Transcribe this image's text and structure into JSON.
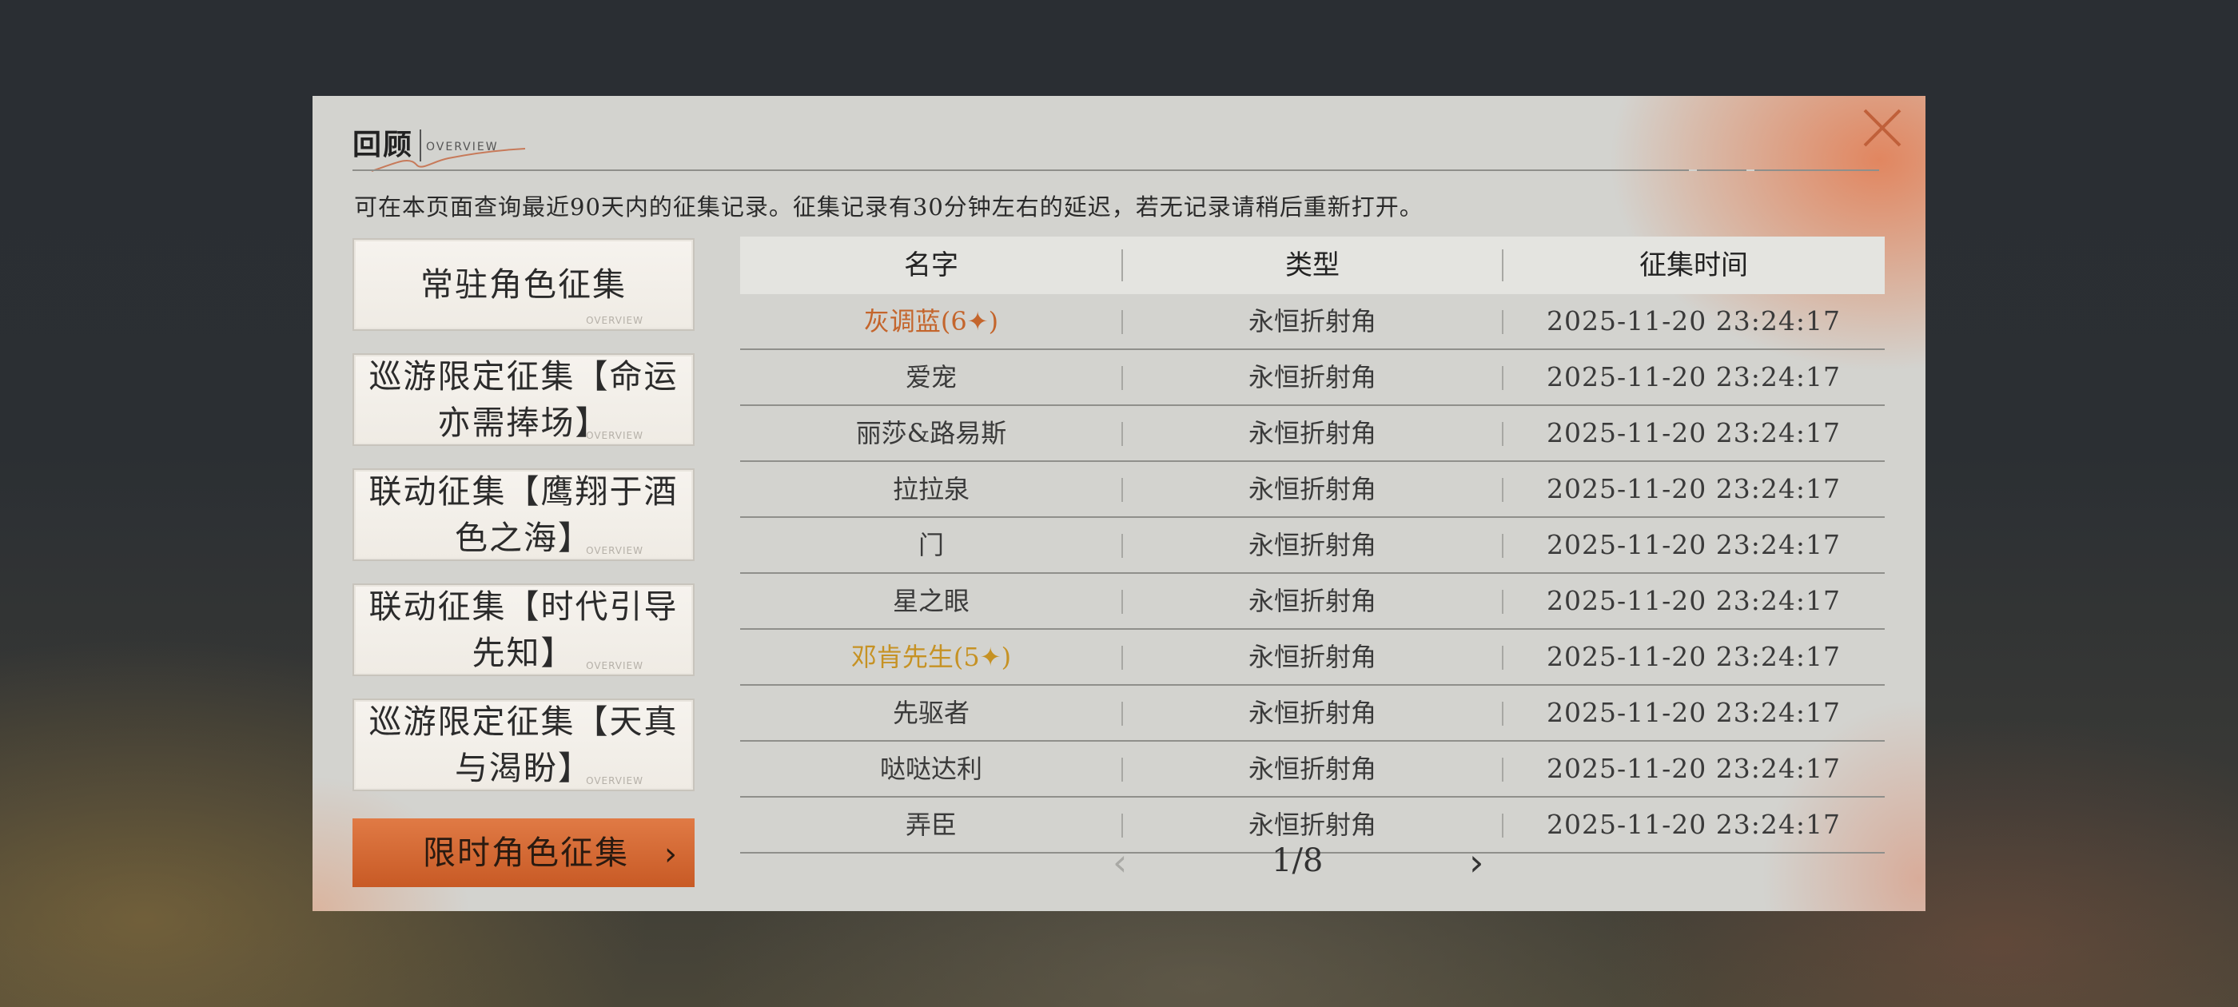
{
  "dialog": {
    "title": "回顾",
    "subtitle": "OVERVIEW",
    "description": "可在本页面查询最近90天内的征集记录。征集记录有30分钟左右的延迟，若无记录请稍后重新打开。",
    "close_icon": "close-icon"
  },
  "tabs": [
    {
      "label": "常驻角色征集",
      "overview": "OVERVIEW",
      "active": false
    },
    {
      "label": "巡游限定征集【命运亦需捧场】",
      "overview": "OVERVIEW",
      "active": false
    },
    {
      "label": "联动征集【鹰翔于酒色之海】",
      "overview": "OVERVIEW",
      "active": false
    },
    {
      "label": "联动征集【时代引导先知】",
      "overview": "OVERVIEW",
      "active": false
    },
    {
      "label": "巡游限定征集【天真与渴盼】",
      "overview": "OVERVIEW",
      "active": false
    },
    {
      "label": "限时角色征集",
      "active": true,
      "icon": "chevron-right-icon"
    }
  ],
  "table": {
    "headers": [
      "名字",
      "类型",
      "征集时间"
    ],
    "rows": [
      {
        "name": "灰调蓝(6✦)",
        "type": "永恒折射角",
        "time": "2025-11-20 23:24:17",
        "highlight": "#c4652c"
      },
      {
        "name": "爱宠",
        "type": "永恒折射角",
        "time": "2025-11-20 23:24:17"
      },
      {
        "name": "丽莎&路易斯",
        "type": "永恒折射角",
        "time": "2025-11-20 23:24:17"
      },
      {
        "name": "拉拉泉",
        "type": "永恒折射角",
        "time": "2025-11-20 23:24:17"
      },
      {
        "name": "门",
        "type": "永恒折射角",
        "time": "2025-11-20 23:24:17"
      },
      {
        "name": "星之眼",
        "type": "永恒折射角",
        "time": "2025-11-20 23:24:17"
      },
      {
        "name": "邓肯先生(5✦)",
        "type": "永恒折射角",
        "time": "2025-11-20 23:24:17",
        "highlight": "#c69224"
      },
      {
        "name": "先驱者",
        "type": "永恒折射角",
        "time": "2025-11-20 23:24:17"
      },
      {
        "name": "哒哒达利",
        "type": "永恒折射角",
        "time": "2025-11-20 23:24:17"
      },
      {
        "name": "弄臣",
        "type": "永恒折射角",
        "time": "2025-11-20 23:24:17"
      }
    ]
  },
  "pager": {
    "text": "1/8",
    "prev": "‹",
    "next": "›",
    "prev_icon": "chevron-left-icon",
    "next_icon": "chevron-right-icon"
  },
  "colors": {
    "accent": "#d4692f",
    "six_star": "#c4652c",
    "five_star": "#c69224",
    "panel": "#d3d3cf"
  }
}
